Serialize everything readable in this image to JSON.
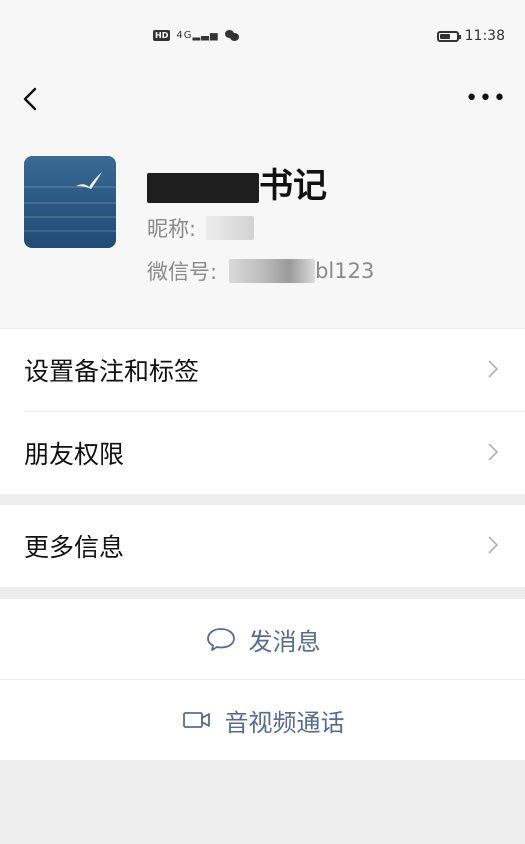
{
  "status_bar": {
    "hd_label": "HD",
    "signal_label": "4G",
    "time": "11:38"
  },
  "nav": {
    "more_label": "•••"
  },
  "profile": {
    "name_suffix": "书记",
    "nickname_label": "昵称:",
    "wechat_id_label": "微信号:",
    "wechat_id_suffix": "bl123"
  },
  "menu": {
    "items": [
      {
        "label": "设置备注和标签"
      },
      {
        "label": "朋友权限"
      },
      {
        "label": "更多信息"
      }
    ]
  },
  "actions": {
    "send_message": "发消息",
    "av_call": "音视频通话"
  },
  "colors": {
    "link": "#576b95",
    "background": "#ededed",
    "card": "#ffffff"
  }
}
